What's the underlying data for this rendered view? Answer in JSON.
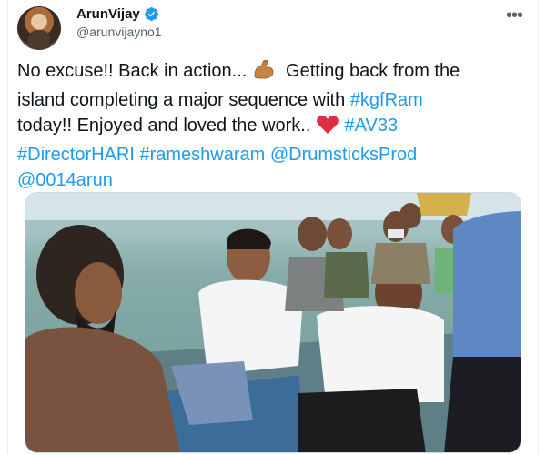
{
  "user": {
    "display_name": "ArunVijay",
    "handle": "@arunvijayno1",
    "verified": true
  },
  "tweet": {
    "line1_text": "No excuse!! Back in action...",
    "line1_emoji": "flexed-biceps",
    "line1_rest": "  Getting back from the",
    "line2_text": "island completing a major sequence with ",
    "line2_tag": "#kgfRam",
    "line3_text": "today!! Enjoyed and loved the work..",
    "line3_emoji": "red-heart",
    "line3_tag": " #AV33",
    "line4_tag1": "#DirectorHARI",
    "line4_tag2": " #rameshwaram",
    "line4_mention": " @DrumsticksProd",
    "line5_mention": "@0014arun"
  },
  "colors": {
    "link": "#1d9bf0",
    "verified_badge": "#1d9bf0",
    "text": "#0f1419",
    "secondary": "#536471"
  },
  "media": {
    "type": "photo",
    "description_icon": "photo"
  }
}
